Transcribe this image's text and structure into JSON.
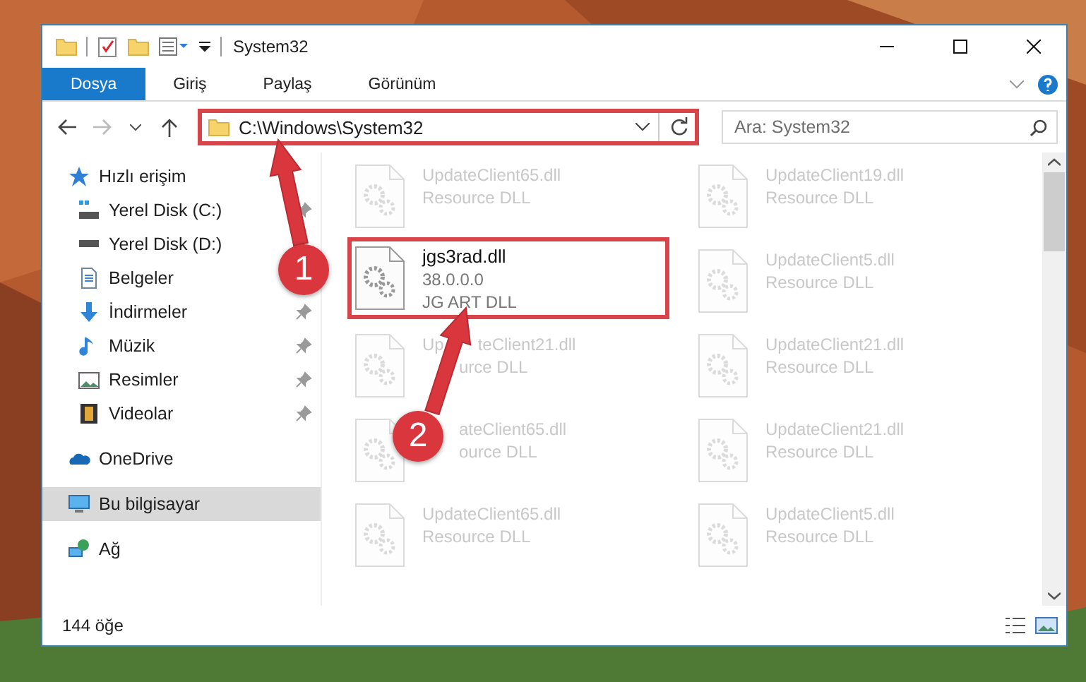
{
  "window": {
    "title": "System32"
  },
  "ribbon": {
    "tabs": [
      {
        "label": "Dosya",
        "kind": "file"
      },
      {
        "label": "Giriş",
        "kind": "tab"
      },
      {
        "label": "Paylaş",
        "kind": "tab"
      },
      {
        "label": "Görünüm",
        "kind": "tab"
      }
    ]
  },
  "address": {
    "path": "C:\\Windows\\System32",
    "highlighted": true
  },
  "search": {
    "placeholder": "Ara: System32"
  },
  "sidebar": {
    "items": [
      {
        "label": "Hızlı erişim",
        "kind": "star",
        "selected": false,
        "children": [
          {
            "label": "Yerel Disk (C:)",
            "kind": "drive-c",
            "pinned": true,
            "selected": false
          },
          {
            "label": "Yerel Disk (D:)",
            "kind": "drive",
            "pinned": false,
            "selected": false
          },
          {
            "label": "Belgeler",
            "kind": "documents",
            "pinned": false,
            "selected": false
          },
          {
            "label": "İndirmeler",
            "kind": "downloads",
            "pinned": true,
            "selected": false
          },
          {
            "label": "Müzik",
            "kind": "music",
            "pinned": true,
            "selected": false
          },
          {
            "label": "Resimler",
            "kind": "pictures",
            "pinned": true,
            "selected": false
          },
          {
            "label": "Videolar",
            "kind": "videos",
            "pinned": true,
            "selected": false
          }
        ]
      },
      {
        "label": "OneDrive",
        "kind": "cloud",
        "selected": false
      },
      {
        "label": "Bu bilgisayar",
        "kind": "computer",
        "selected": true
      },
      {
        "label": "Ağ",
        "kind": "network",
        "selected": false
      }
    ]
  },
  "files": [
    {
      "lines": [
        "UpdateClient65.dll",
        "Resource DLL"
      ],
      "highlighted": false
    },
    {
      "lines": [
        "UpdateClient19.dll",
        "Resource DLL"
      ],
      "highlighted": false
    },
    {
      "lines": [
        "jgs3rad.dll",
        "38.0.0.0",
        "JG ART DLL"
      ],
      "highlighted": true
    },
    {
      "lines": [
        "UpdateClient5.dll",
        "Resource DLL"
      ],
      "highlighted": false
    },
    {
      "lines": [
        {
          "parts": [
            "Up",
            "teClient21.dll"
          ]
        },
        {
          "parts": [
            "urce DLL"
          ],
          "covered_start": true
        }
      ],
      "highlighted": false
    },
    {
      "lines": [
        "UpdateClient21.dll",
        "Resource DLL"
      ],
      "highlighted": false
    },
    {
      "lines": [
        {
          "parts": [
            "ateClient65.dll"
          ],
          "covered_start": true
        },
        {
          "parts": [
            "ource DLL"
          ],
          "covered_start": true
        }
      ],
      "highlighted": false
    },
    {
      "lines": [
        "UpdateClient21.dll",
        "Resource DLL"
      ],
      "highlighted": false
    },
    {
      "lines": [
        "UpdateClient65.dll",
        "Resource DLL"
      ],
      "highlighted": false
    },
    {
      "lines": [
        "UpdateClient5.dll",
        "Resource DLL"
      ],
      "highlighted": false
    }
  ],
  "status_bar": {
    "count": "144 öğe"
  },
  "annotations": [
    {
      "number": "1"
    },
    {
      "number": "2"
    }
  ]
}
